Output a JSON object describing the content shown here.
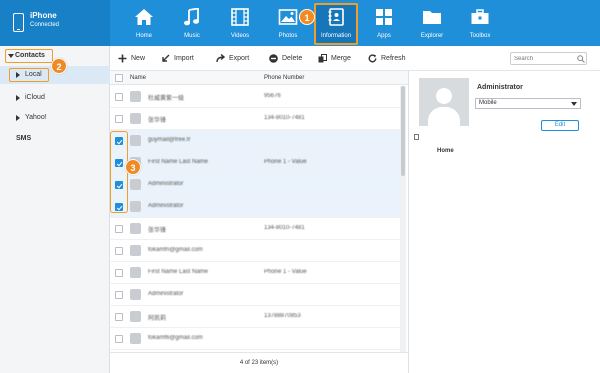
{
  "device": {
    "name": "iPhone",
    "status": "Connected"
  },
  "nav": [
    {
      "label": "Home",
      "icon": "home-icon"
    },
    {
      "label": "Music",
      "icon": "music-icon"
    },
    {
      "label": "Videos",
      "icon": "film-icon"
    },
    {
      "label": "Photos",
      "icon": "image-icon"
    },
    {
      "label": "Information",
      "icon": "contacts-book-icon",
      "active": true
    },
    {
      "label": "Apps",
      "icon": "apps-grid-icon"
    },
    {
      "label": "Explorer",
      "icon": "folder-icon"
    },
    {
      "label": "Toolbox",
      "icon": "toolbox-icon"
    }
  ],
  "callouts": [
    "1",
    "2",
    "3"
  ],
  "sidebar": {
    "contacts": "Contacts",
    "items": [
      "Local",
      "iCloud",
      "Yahoo!"
    ],
    "sms": "SMS"
  },
  "toolbar": {
    "new": "New",
    "import": "Import",
    "export": "Export",
    "delete": "Delete",
    "merge": "Merge",
    "refresh": "Refresh",
    "search_placeholder": "Search"
  },
  "table": {
    "columns": [
      "Name",
      "Phone Number"
    ],
    "rows": [
      {
        "name": "杜威黄紫一级",
        "phone": "95676",
        "checked": false
      },
      {
        "name": "张华锋",
        "phone": "134-8010-7481",
        "checked": false
      },
      {
        "name": "guymail@free.fr",
        "phone": "",
        "checked": true
      },
      {
        "name": "First Name Last Name",
        "phone": "Phone 1 - Value",
        "checked": true
      },
      {
        "name": "Administrator",
        "phone": "",
        "checked": true
      },
      {
        "name": "Administrator",
        "phone": "",
        "checked": true
      },
      {
        "name": "张华锋",
        "phone": "134-8010-7481",
        "checked": false
      },
      {
        "name": "fokamfn@gmail.com",
        "phone": "",
        "checked": false
      },
      {
        "name": "First Name Last Name",
        "phone": "Phone 1 - Value",
        "checked": false
      },
      {
        "name": "Administrator",
        "phone": "",
        "checked": false
      },
      {
        "name": "阿凯莉",
        "phone": "13788870853",
        "checked": false
      },
      {
        "name": "fokamf6@gmail.com",
        "phone": "",
        "checked": false
      }
    ],
    "footer": "4 of 23 item(s)"
  },
  "detail": {
    "name": "Administrator",
    "phone_type": "Mobile",
    "edit": "Edit",
    "address_label": "Home"
  },
  "colors": {
    "header": "#1e8fd8",
    "accent": "#f08a24",
    "selected_row": "#eaf3fb"
  }
}
